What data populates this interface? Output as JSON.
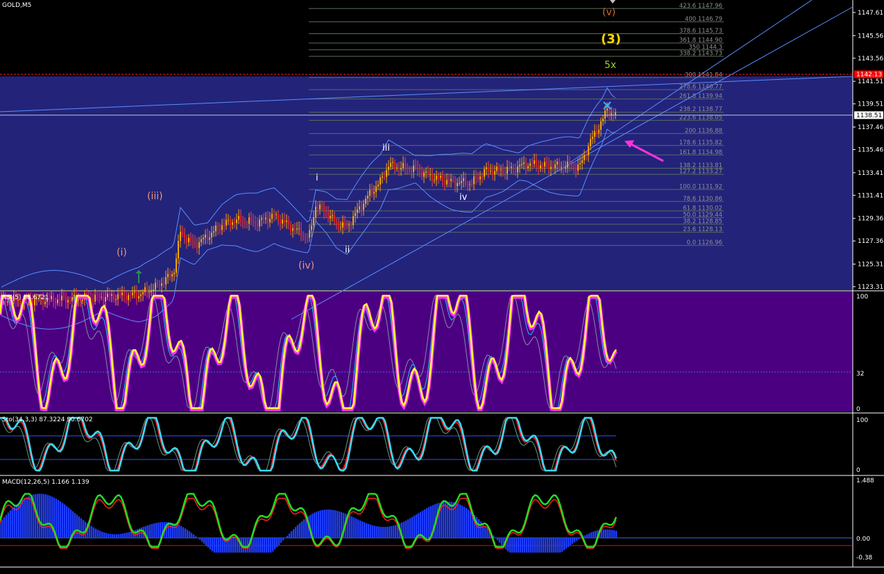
{
  "panels": {
    "main": {
      "label": "GOLD,M5",
      "price_ticks": [
        "1147.61",
        "1145.56",
        "1143.56",
        "1141.51",
        "1139.51",
        "1137.46",
        "1135.46",
        "1133.41",
        "1131.41",
        "1129.36",
        "1127.36",
        "1125.31",
        "1123.31"
      ],
      "tick_values": [
        1147.61,
        1145.56,
        1143.56,
        1141.51,
        1139.51,
        1137.46,
        1135.46,
        1133.41,
        1131.41,
        1129.36,
        1127.36,
        1125.31,
        1123.31
      ],
      "price_range": [
        1122.9,
        1148.4
      ],
      "current_price": "1138.51",
      "red_line_price": "1142.13",
      "red_line_value": 1142.13,
      "current_value": 1138.51
    },
    "rsi": {
      "label": "RSI(5) 66.6721",
      "levels": [
        "100",
        "32",
        "0"
      ]
    },
    "sto": {
      "label": "Sto(34,3,3) 87.3224 90.6702",
      "levels": [
        "100",
        "0"
      ]
    },
    "macd": {
      "label": "MACD(12,26,5) 1.166 1.139",
      "levels": [
        "1.488",
        "0.00",
        "-0.38"
      ]
    }
  },
  "fib_levels": [
    {
      "text": "423.6 1147.96",
      "value": 1147.96
    },
    {
      "text": "400 1146.79",
      "value": 1146.79
    },
    {
      "text": "378.6 1145.73",
      "value": 1145.73
    },
    {
      "text": "361.8 1144.90",
      "value": 1144.9
    },
    {
      "text": "350 1144.3",
      "value": 1144.3
    },
    {
      "text": "338.2 1143.73",
      "value": 1143.73
    },
    {
      "text": "300 1141.84",
      "value": 1141.84
    },
    {
      "text": "278.6 1140.77",
      "value": 1140.77
    },
    {
      "text": "261.8 1139.94",
      "value": 1139.94
    },
    {
      "text": "238.2 1138.77",
      "value": 1138.77
    },
    {
      "text": "223.6 1138.05",
      "value": 1138.05
    },
    {
      "text": "200 1136.88",
      "value": 1136.88
    },
    {
      "text": "178.6 1135.82",
      "value": 1135.82
    },
    {
      "text": "161.8 1134.98",
      "value": 1134.98
    },
    {
      "text": "138.2 1133.81",
      "value": 1133.81
    },
    {
      "text": "127.2 1133.27",
      "value": 1133.27
    },
    {
      "text": "100.0 1131.92",
      "value": 1131.92
    },
    {
      "text": "78.6 1130.86",
      "value": 1130.86
    },
    {
      "text": "61.8 1130.02",
      "value": 1130.02
    },
    {
      "text": "50.0 1129.44",
      "value": 1129.44
    },
    {
      "text": "38.2 1128.85",
      "value": 1128.85
    },
    {
      "text": "23.6 1128.13",
      "value": 1128.13
    },
    {
      "text": "0.0 1126.96",
      "value": 1126.96
    }
  ],
  "wave_labels": {
    "v_paren": "(v)",
    "three": "(3)",
    "fivex": "5x",
    "iii_paren": "(iii)",
    "i_paren": "(i)",
    "iv_paren": "(iv)",
    "i": "i",
    "ii": "ii",
    "iii": "iii",
    "iv": "iv"
  },
  "chart_data": {
    "type": "line",
    "symbol": "GOLD",
    "timeframe": "M5",
    "price_path": [
      [
        0,
        1122.0
      ],
      [
        100,
        1122.2
      ],
      [
        200,
        1122.6
      ],
      [
        225,
        1123.3
      ],
      [
        250,
        1124.5
      ],
      [
        260,
        1128.1
      ],
      [
        280,
        1127.0
      ],
      [
        300,
        1127.8
      ],
      [
        320,
        1128.8
      ],
      [
        340,
        1129.2
      ],
      [
        370,
        1129.0
      ],
      [
        395,
        1129.6
      ],
      [
        420,
        1128.6
      ],
      [
        445,
        1127.6
      ],
      [
        455,
        1130.5
      ],
      [
        470,
        1129.9
      ],
      [
        485,
        1128.9
      ],
      [
        500,
        1128.6
      ],
      [
        515,
        1130.0
      ],
      [
        535,
        1131.7
      ],
      [
        548,
        1132.6
      ],
      [
        560,
        1134.1
      ],
      [
        575,
        1133.9
      ],
      [
        600,
        1133.7
      ],
      [
        620,
        1133.1
      ],
      [
        650,
        1132.6
      ],
      [
        680,
        1132.5
      ],
      [
        700,
        1133.6
      ],
      [
        725,
        1133.6
      ],
      [
        745,
        1133.9
      ],
      [
        760,
        1134.2
      ],
      [
        790,
        1134.0
      ],
      [
        820,
        1134.0
      ],
      [
        835,
        1133.9
      ],
      [
        848,
        1135.8
      ],
      [
        858,
        1137.0
      ],
      [
        868,
        1138.0
      ],
      [
        875,
        1139.1
      ],
      [
        882,
        1138.6
      ],
      [
        888,
        1138.51
      ]
    ],
    "rsi_current": 66.6721,
    "sto_main": 87.3224,
    "sto_signal": 90.6702,
    "macd_main": 1.166,
    "macd_signal": 1.139,
    "macd_range": [
      -0.38,
      1.488
    ]
  }
}
